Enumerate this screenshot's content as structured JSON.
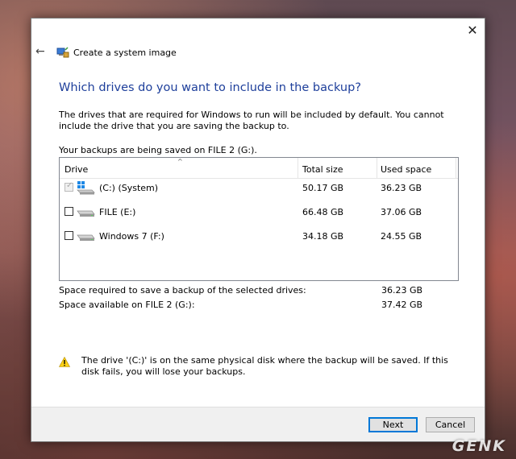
{
  "window": {
    "title": "Create a system image",
    "close_glyph": "✕",
    "back_glyph": "←"
  },
  "heading": "Which drives do you want to include in the backup?",
  "description": "The drives that are required for Windows to run will be included by default. You cannot include the drive that you are saving the backup to.",
  "saved_on": "Your backups are being saved on FILE 2 (G:).",
  "table": {
    "columns": [
      "Drive",
      "Total size",
      "Used space"
    ],
    "sort_glyph": "^",
    "rows": [
      {
        "name": "(C:) (System)",
        "total": "50.17 GB",
        "used": "36.23 GB",
        "checked": true,
        "disabled": true,
        "icon": "windows-drive-icon"
      },
      {
        "name": "FILE (E:)",
        "total": "66.48 GB",
        "used": "37.06 GB",
        "checked": false,
        "disabled": false,
        "icon": "drive-icon"
      },
      {
        "name": "Windows 7 (F:)",
        "total": "34.18 GB",
        "used": "24.55 GB",
        "checked": false,
        "disabled": false,
        "icon": "drive-icon"
      }
    ]
  },
  "summary": {
    "required_label": "Space required to save a backup of the selected drives:",
    "required_value": "36.23 GB",
    "available_label": "Space available on FILE 2 (G:):",
    "available_value": "37.42 GB"
  },
  "warning": "The drive '(C:)' is on the same physical disk where the backup will be saved. If this disk fails, you will lose your backups.",
  "buttons": {
    "next": "Next",
    "cancel": "Cancel"
  },
  "watermark": "GENK",
  "colors": {
    "heading": "#1e3f9b",
    "accent": "#0078d7"
  }
}
